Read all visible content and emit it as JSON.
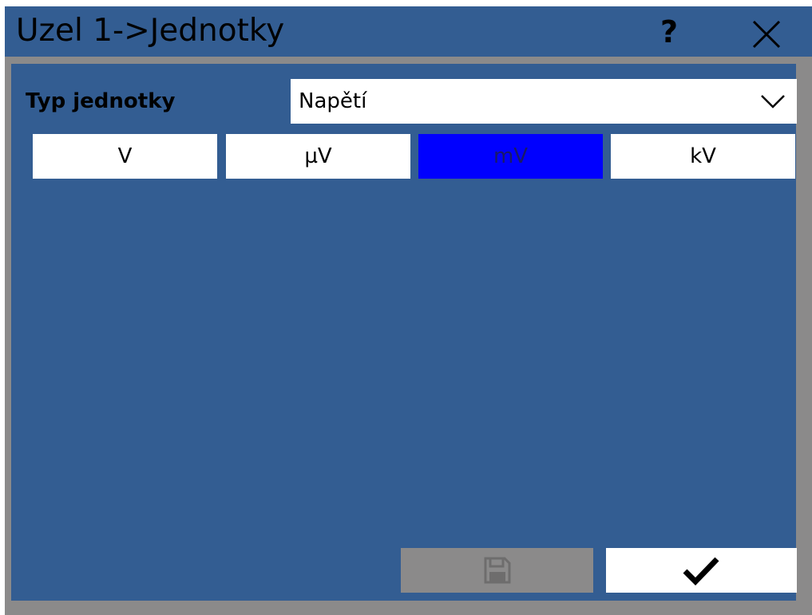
{
  "window": {
    "title": "Uzel 1->Jednotky",
    "help_label": "?"
  },
  "unit_type": {
    "label": "Typ jednotky",
    "selected_value": "Napětí"
  },
  "units": [
    {
      "label": "V",
      "selected": false
    },
    {
      "label": "µV",
      "selected": false
    },
    {
      "label": "mV",
      "selected": true
    },
    {
      "label": "kV",
      "selected": false
    }
  ],
  "footer": {
    "save_icon": "save-icon",
    "save_enabled": false,
    "confirm_icon": "check-icon"
  },
  "colors": {
    "background": "#335d92",
    "selected": "#0000ff",
    "disabled": "#8b8a8a"
  }
}
